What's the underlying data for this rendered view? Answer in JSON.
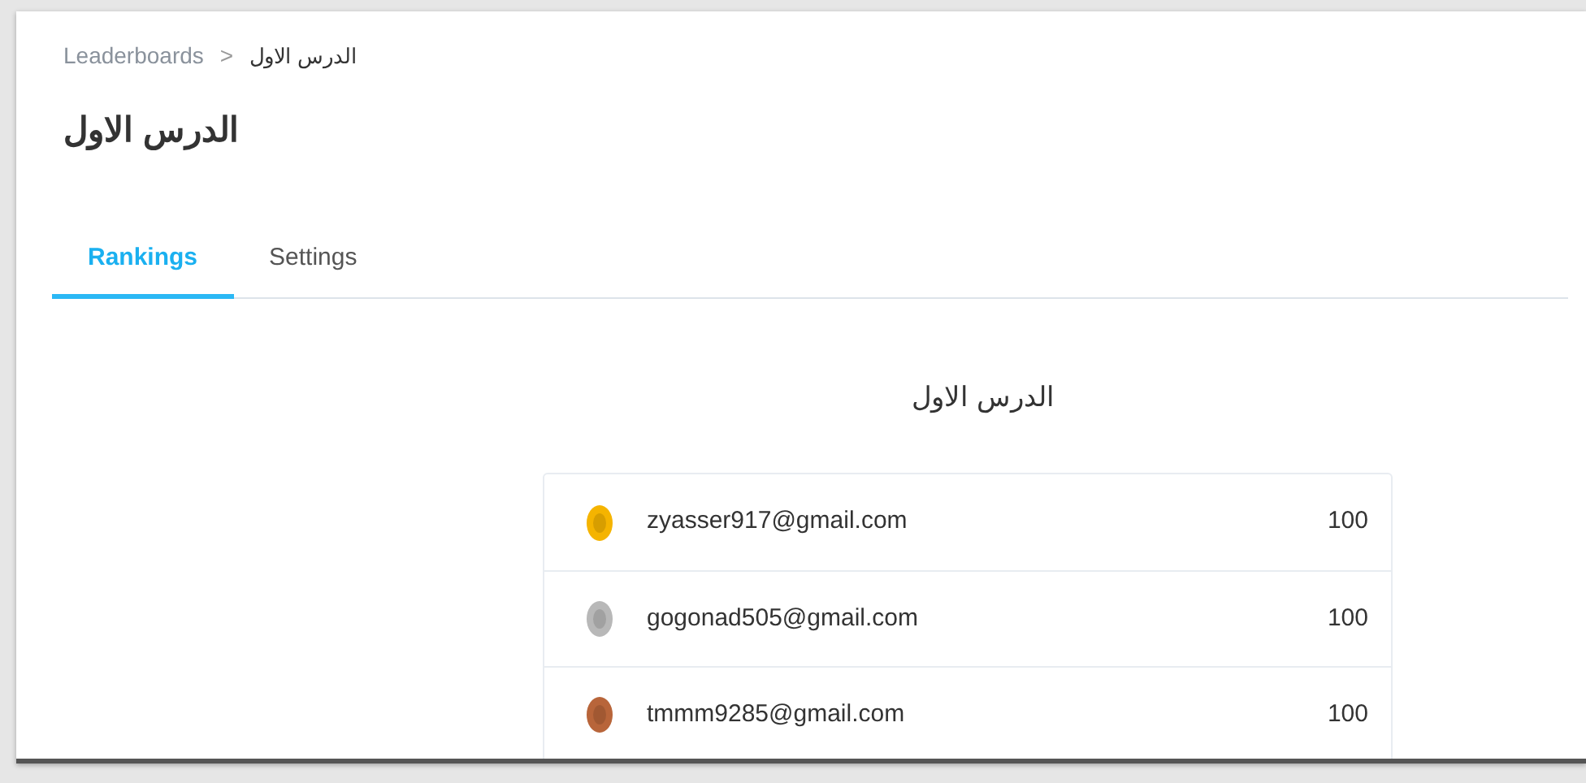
{
  "breadcrumb": {
    "items": [
      "Leaderboards",
      "الدرس الاول"
    ],
    "separator": ">"
  },
  "title": "الدرس الاول",
  "tabs": [
    {
      "label": "Rankings",
      "selected": true
    },
    {
      "label": "Settings",
      "selected": false
    }
  ],
  "leaderboard": {
    "title": "الدرس الاول",
    "rows": [
      {
        "color": "#f5b400",
        "email": "zyasser917@gmail.com",
        "score": "100"
      },
      {
        "color": "#b8b8b8",
        "email": "gogonad505@gmail.com",
        "score": "100"
      },
      {
        "color": "#b8653a",
        "email": "tmmm9285@gmail.com",
        "score": "100"
      }
    ]
  }
}
